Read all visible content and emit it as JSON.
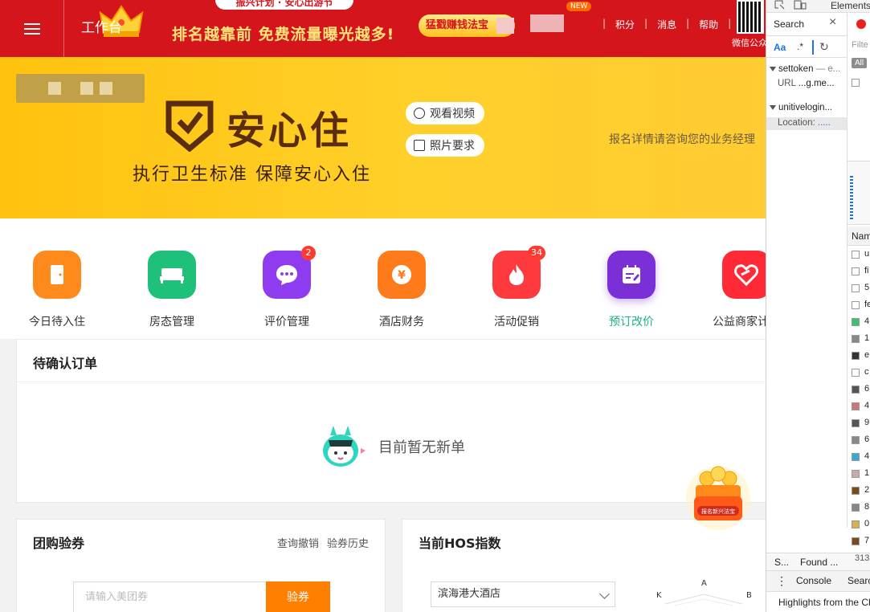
{
  "topbar": {
    "workbench_label": "工作台",
    "promo_top": "振兴计划 · 安心出游节",
    "promo_main": "排名越靠前 免费流量曝光越多!",
    "promo_button": "猛戳赚钱法宝",
    "new_badge": "NEW",
    "links": [
      "积分",
      "消息",
      "帮助"
    ],
    "qr_label": "微信公众号"
  },
  "banner": {
    "brand": "安心住",
    "slogan": "执行卫生标准 保障安心入住",
    "watch_video": "观看视频",
    "photo_requirements": "照片要求",
    "note": "报名详情请咨询您的业务经理"
  },
  "quick_icons": [
    {
      "label": "今日待入住",
      "color": "#ff8a1c",
      "icon": "door-icon",
      "badge": ""
    },
    {
      "label": "房态管理",
      "color": "#1fc07a",
      "icon": "bed-icon",
      "badge": ""
    },
    {
      "label": "评价管理",
      "color": "#8f3cf0",
      "icon": "chat-icon",
      "badge": "2"
    },
    {
      "label": "酒店财务",
      "color": "#ff7a1a",
      "icon": "yen-icon",
      "badge": ""
    },
    {
      "label": "活动促销",
      "color": "#ff3a3f",
      "icon": "flame-icon",
      "badge": "34"
    },
    {
      "label": "预订改价",
      "color": "#7b2fd6",
      "icon": "calendar-edit-icon",
      "badge": ""
    },
    {
      "label": "公益商家计划",
      "color": "#ff2a35",
      "icon": "heart-icon",
      "badge": ""
    }
  ],
  "pending_orders": {
    "title": "待确认订单",
    "empty_text": "目前暂无新单"
  },
  "group_voucher": {
    "title": "团购验券",
    "link_cancel": "查询撤销",
    "link_history": "验券历史",
    "input_placeholder": "请输入美团券",
    "button": "验券"
  },
  "hos_index": {
    "title": "当前HOS指数",
    "hotel": "滨海港大酒店",
    "radar_labels": [
      "A",
      "K",
      "B"
    ]
  },
  "treasure_label": "报名新兴法宝",
  "devtools": {
    "top_tab": "Elements",
    "search_tab": "Search",
    "case_toggle": "Aa",
    "regex_toggle": ".*",
    "results": [
      {
        "name": "settoken",
        "suffix": "— e...",
        "key": "URL",
        "value": "...g.me..."
      },
      {
        "name": "unitivelogin...",
        "suffix": "",
        "key": "Location:",
        "value": "....."
      }
    ],
    "filter_placeholder": "Filte",
    "all_label": "All",
    "name_header": "Nam",
    "network_rows": [
      "u",
      "fi",
      "5",
      "fe",
      "4",
      "1",
      "e",
      "c",
      "6",
      "4",
      "9",
      "6",
      "4",
      "1",
      "2",
      "8",
      "0",
      "7"
    ],
    "status_left": "S...",
    "status_found": "Found ...",
    "status_count": "313",
    "drawer_console": "Console",
    "drawer_search": "Searc",
    "highlights": "Highlights from the Ch"
  }
}
